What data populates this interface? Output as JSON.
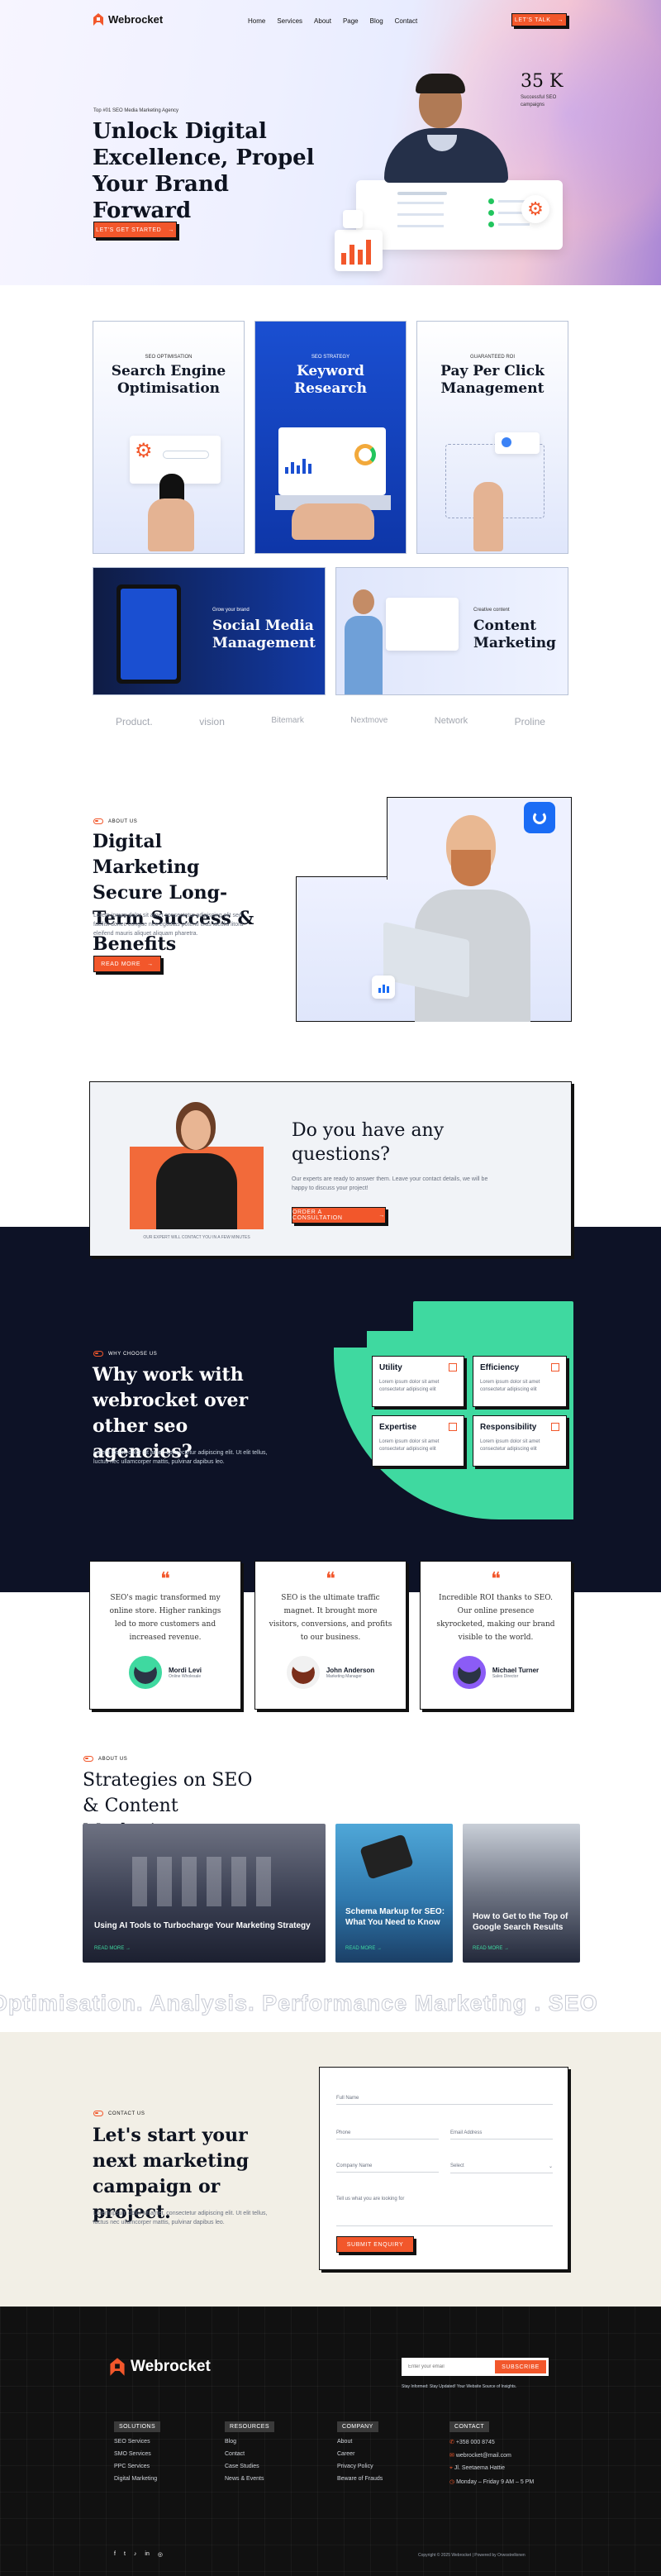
{
  "brand": {
    "name": "Webrocket",
    "accent": "#f2572b",
    "dark": "#0d1226",
    "green": "#3fd9a0"
  },
  "nav": {
    "items": [
      "Home",
      "Services",
      "About",
      "Page",
      "Blog",
      "Contact"
    ],
    "cta": "Let's Talk"
  },
  "hero": {
    "tag": "Top #01 SEO Media Marketing Agency",
    "title": "Unlock Digital Excellence, Propel Your Brand Forward",
    "cta": "Let's Get Started",
    "stat_value": "35 K",
    "stat_label": "Successful SEO campaigns"
  },
  "services": [
    {
      "tag": "SEO Optimisation",
      "title": "Search Engine Optimisation"
    },
    {
      "tag": "SEO Strategy",
      "title": "Keyword Research"
    },
    {
      "tag": "Guaranteed ROI",
      "title": "Pay Per Click Management"
    },
    {
      "tag": "Grow your brand",
      "title": "Social Media Management"
    },
    {
      "tag": "Creative content",
      "title": "Content Marketing"
    }
  ],
  "logos": [
    "Product.",
    "vision",
    "Bitemark",
    "Nextmove",
    "Network",
    "Proline"
  ],
  "about": {
    "tag": "About us",
    "title": "Digital Marketing Secure Long-Term Success & Benefits",
    "text": "Lorem ipsum dolor sit amet consectetur adipiscing elit sed facilisi donec congue nec egestas potenti cras iaculis litora eleifend mauris aliquet aliquam pharetra.",
    "cta": "Read More"
  },
  "questions": {
    "title": "Do you have any questions?",
    "text": "Our experts are ready to answer them. Leave your contact details, we will be happy to discuss your project!",
    "cta": "Order a Consultation",
    "caption": "Our expert will contact you in a few minutes"
  },
  "why": {
    "tag": "Why choose us",
    "title": "Why work with webrocket over other seo agencies?",
    "text": "Lorem ipsum dolor sit amet, consectetur adipiscing elit. Ut elit tellus, luctus nec ullamcorper mattis, pulvinar dapibus leo.",
    "features": [
      {
        "title": "Utility",
        "text": "Lorem ipsum dolor sit amet consectetur adipiscing elit"
      },
      {
        "title": "Efficiency",
        "text": "Lorem ipsum dolor sit amet consectetur adipiscing elit"
      },
      {
        "title": "Expertise",
        "text": "Lorem ipsum dolor sit amet consectetur adipiscing elit"
      },
      {
        "title": "Responsibility",
        "text": "Lorem ipsum dolor sit amet consectetur adipiscing elit"
      }
    ]
  },
  "testimonials": [
    {
      "quote": "SEO's magic transformed my online store. Higher rankings led to more customers and increased revenue.",
      "name": "Mordi Levi",
      "role": "Online Wholesale"
    },
    {
      "quote": "SEO is the ultimate traffic magnet. It brought more visitors, conversions, and profits to our business.",
      "name": "John Anderson",
      "role": "Marketing Manager"
    },
    {
      "quote": "Incredible ROI thanks to SEO. Our online presence skyrocketed, making our brand visible to the world.",
      "name": "Michael Turner",
      "role": "Sales Director"
    }
  ],
  "blog": {
    "tag": "About us",
    "title": "Strategies on SEO & Content Marketing",
    "posts": [
      {
        "title": "Using AI Tools to Turbocharge Your Marketing Strategy",
        "link": "Read More"
      },
      {
        "title": "Schema Markup for SEO: What You Need to Know",
        "link": "Read More"
      },
      {
        "title": "How to Get to the Top of Google Search Results",
        "link": "Read More"
      }
    ]
  },
  "marquee": "Optimisation. Analysis. Performance Marketing . SEO",
  "contact": {
    "tag": "Contact us",
    "title": "Let's start your next marketing campaign or project.",
    "text": "Lorem ipsum dolor sit amet, consectetur adipiscing elit. Ut elit tellus, luctus nec ullamcorper mattis, pulvinar dapibus leo.",
    "fields": {
      "name": "Full Name",
      "phone": "Phone",
      "email": "Email Address",
      "company": "Company Name",
      "select": "Select",
      "message": "Tell us what you are looking for"
    },
    "submit": "Submit Enquiry"
  },
  "footer": {
    "email_placeholder": "Enter your email",
    "subscribe": "Subscribe",
    "subtext": "Stay Informed: Stay Updated! Your Website Source of Insights.",
    "columns": [
      {
        "title": "Solutions",
        "items": [
          "SEO Services",
          "SMO Services",
          "PPC Services",
          "Digital Marketing"
        ]
      },
      {
        "title": "Resources",
        "items": [
          "Blog",
          "Contact",
          "Case Studies",
          "News & Events"
        ]
      },
      {
        "title": "Company",
        "items": [
          "About",
          "Career",
          "Privacy Policy",
          "Beware of Frauds"
        ]
      },
      {
        "title": "Contact",
        "items": [
          "+358 000 8745",
          "webrocket@mail.com",
          "Jl. Seetaema Hattie",
          "Monday – Friday 9 AM – 5 PM"
        ]
      }
    ],
    "copyright": "Copyright © 2025 Webrocket | Powered by Orwostrellonen"
  }
}
